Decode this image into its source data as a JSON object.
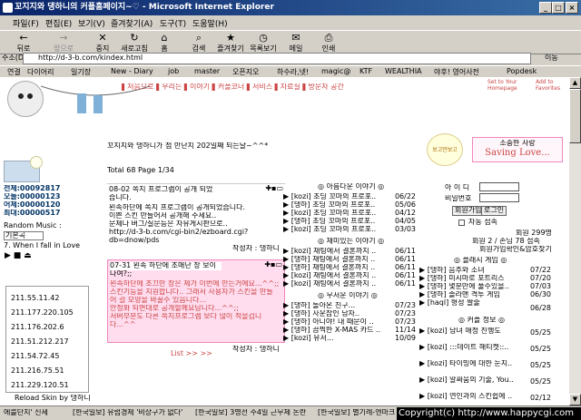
{
  "window": {
    "title": "꼬지지와 댕하니의 커플홈페이지~♡ - Microsoft Internet Explorer",
    "minimize": "_",
    "maximize": "□",
    "close": "×"
  },
  "menu": [
    "파일(F)",
    "편집(E)",
    "보기(V)",
    "즐겨찾기(A)",
    "도구(T)",
    "도움말(H)"
  ],
  "toolbar": [
    {
      "label": "뒤로",
      "icon": "←"
    },
    {
      "label": "앞으로",
      "icon": "→"
    },
    {
      "label": "중지",
      "icon": "✕"
    },
    {
      "label": "새로고침",
      "icon": "↻"
    },
    {
      "label": "홈",
      "icon": "⌂"
    },
    {
      "label": "검색",
      "icon": "⌕"
    },
    {
      "label": "즐겨찾기",
      "icon": "★"
    },
    {
      "label": "목록보기",
      "icon": "◷"
    },
    {
      "label": "메일",
      "icon": "✉"
    },
    {
      "label": "인쇄",
      "icon": "⎙"
    }
  ],
  "address": {
    "label": "주소(D)",
    "url": "http://d-3-b.com/kindex.html",
    "go": "이동"
  },
  "links": {
    "label": "연결",
    "items": [
      "다이어리",
      "일기장",
      "New - Diary",
      "job",
      "master",
      "오픈지오",
      "하수라,넷!",
      "magic@",
      "KTF",
      "WEALTHIA",
      "야후! 영어사전",
      "Popdesk"
    ]
  },
  "page": {
    "nav": "▌처음으로 ▌우리는 ▌이야기 ▌커플코너 ▌서비스 ▌자료실 ▌방문자 공간",
    "set_home": "Set to Your Homepage",
    "add_fav": "Add to Favorites",
    "greeting": "꼬지지와 댕하니가 첨 만난지 202일째 되는날~^^*",
    "stats": {
      "total": "전체:00092817",
      "today": "오늘:00000123",
      "yesterday": "어제:00000120",
      "max": "최대:00000517"
    },
    "radio": {
      "label": "Random Music :",
      "select": "기본곡",
      "song": "7. When I fall in Love",
      "controls": "▶ ■ ⏏"
    },
    "ips": [
      "211.55.11.42",
      "211.177.220.105",
      "211.176.202.6",
      "211.51.212.217",
      "211.54.72.45",
      "211.216.75.51",
      "211.229.120.51"
    ],
    "reload": "Reload Skin by 댕하니",
    "board": {
      "total": "Total 68 Page 1/34",
      "posts": [
        {
          "date": "08-02",
          "title": "쪽지 프로그램이 공개 되었",
          "body": [
            "습니다.",
            "",
            "왼족하단에 쪽지 프로그램이 공개되었습니다.",
            "이쁜 스킨 만들어서 공개해 주세요..",
            "문제나 버그/질문등은 자유게시판으로..",
            "http://d-3-b.com/cgi-bin2/ezboard.cgi?",
            "db=dnow/pds"
          ],
          "author": "작성자 : 댕하니"
        },
        {
          "date": "07-31",
          "title": "왼족 하단에 조매난 창 보이",
          "body": [
            "나여?;;",
            "",
            "왼족하단에 조끄만 창은 제가 이번에 만든거에요...^^;;",
            "스킨기능을 지원합니다.. 그래서 사용자가 스킨을 만들",
            "어 걸 모양을 바꿀수 있읍니다...",
            "안정화 되면대로 공개할께요답니다...^^;;",
            "서버부분도 다른 쪽지프로그램 보다 많이 적을겁니",
            "다...^^"
          ],
          "author": "작성자 : 댕하니"
        }
      ],
      "pager": "List >> >>"
    },
    "sections": [
      {
        "title": "◎ 아름다운 이야기 ◎",
        "rows": [
          [
            "[kozi] 초딩 꼬마의 프로포..",
            "06/22"
          ],
          [
            "[댕하] 초딩 꼬마의 프로포..",
            "05/06"
          ],
          [
            "[kozi] 초딩 꼬마의 프로포..",
            "04/12"
          ],
          [
            "[댕하] 초딩 꼬마의 프로포..",
            "04/05"
          ],
          [
            "[kozi] 초딩 꼬마의 프로포..",
            "03/03"
          ]
        ]
      },
      {
        "title": "◎ 재미있는 이야기 ◎",
        "rows": [
          [
            "[kozi] 채팅에서 결혼까지 ..",
            "06/11"
          ],
          [
            "[댕하] 채팅에서 결혼까지 ..",
            "06/11"
          ],
          [
            "[댕하] 채팅에서 결혼까지 ..",
            "06/11"
          ],
          [
            "[kozi] 채팅에서 결혼까지 ..",
            "06/11"
          ],
          [
            "[kozi] 채팅에서 결혼까지 ..",
            "06/11"
          ]
        ]
      },
      {
        "title": "◎ 무서운 이야기 ◎",
        "rows": [
          [
            "[댕하] 돌아온 친구...",
            "07/23"
          ],
          [
            "[댕하] 사운잡인 남자..",
            "07/23"
          ],
          [
            "[댕하] 아니야! 내 때문이 ..",
            "07/23"
          ],
          [
            "[댕하] 끔찍한 X-MAS 카드 ..",
            "11/14"
          ],
          [
            "[kozi] 유서...",
            "10/09"
          ]
        ]
      }
    ],
    "sidebar": {
      "bear": "보고만보고",
      "love_title": "소중한 사랑",
      "love_sub": "Saving Love...",
      "id_label": "아 이 디",
      "pw_label": "비밀번호",
      "join": "회원가입",
      "login": "로그인",
      "auto": "자동 접속",
      "members": "회원 299명",
      "online": "회원 2 / 손님 78 접속",
      "confirm": "회원가입확인&암호찾기",
      "flash_title": "◎ 플래시 게임 ◎",
      "flash": [
        [
          "[댕하] 음추와 소녀",
          "07/22"
        ],
        [
          "[댕하] 미시마로 포트리스",
          "07/20"
        ],
        [
          "[댕하] 몇분만에 풀수있을..",
          "07/03"
        ],
        [
          "[댕하] 졸라맨 격투 게임",
          "06/30"
        ],
        [
          "[haql] 형성 쌀술",
          "06/28"
        ]
      ],
      "couple_title": "◎ 커플 정보 ◎",
      "couple": [
        [
          "[kozi] 남녀 애정 진행도",
          "05/25"
        ],
        [
          "[kozi] :::데이트 해티켓::..",
          "05/25"
        ],
        [
          "[kozi] 타이밍에 대한 눈치..",
          "05/25"
        ],
        [
          "[kozi] 말싸움의 기술, You..",
          "05/25"
        ],
        [
          "[kozi] 연인과의 스킨쉽에 ..",
          "02/12"
        ]
      ]
    }
  },
  "status": {
    "items": [
      "에를단지' 신세",
      "[한국일보] 유럽경제 '비상구가 없다'",
      "[한국일보] 3명선 주4일 근무제 논란",
      "[한국일보] 별기례-엔마크"
    ],
    "copyright": "Copyright(c) http://www.happycgi.com"
  },
  "colors": {
    "title_blue": "#0a246a",
    "accent": "#c44",
    "link": "#0645a5"
  }
}
